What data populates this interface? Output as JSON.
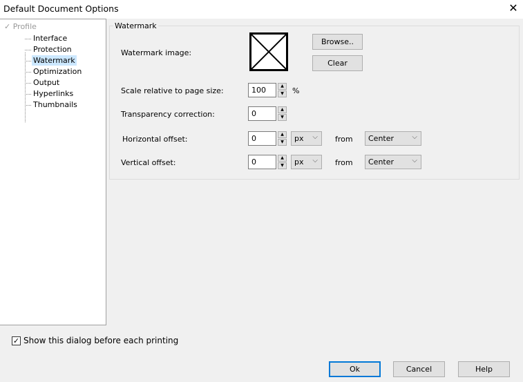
{
  "window": {
    "title": "Default Document Options",
    "close_icon": "close-icon"
  },
  "tree": {
    "root": "Profile",
    "items": [
      {
        "label": "Interface"
      },
      {
        "label": "Protection"
      },
      {
        "label": "Watermark",
        "selected": true
      },
      {
        "label": "Optimization"
      },
      {
        "label": "Output"
      },
      {
        "label": "Hyperlinks"
      },
      {
        "label": "Thumbnails"
      }
    ]
  },
  "watermark": {
    "group_title": "Watermark",
    "image_label": "Watermark image:",
    "browse": "Browse..",
    "clear": "Clear",
    "scale_label": "Scale relative to page size:",
    "scale_value": "100",
    "scale_unit": "%",
    "transparency_label": "Transparency correction:",
    "transparency_value": "0",
    "h_label": "Horizontal offset:",
    "h_value": "0",
    "h_unit": "px",
    "h_from": "from",
    "h_anchor": "Center",
    "v_label": "Vertical offset:",
    "v_value": "0",
    "v_unit": "px",
    "v_from": "from",
    "v_anchor": "Center"
  },
  "footer": {
    "show_dialog": "Show this dialog before each printing",
    "show_checked": true,
    "ok": "Ok",
    "cancel": "Cancel",
    "help": "Help"
  }
}
